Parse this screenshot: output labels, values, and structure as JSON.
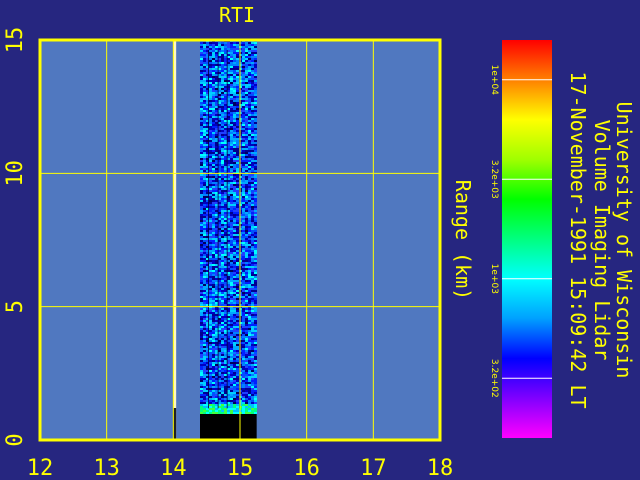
{
  "chart_data": {
    "type": "heatmap",
    "title": "RTI",
    "xlabel": "",
    "ylabel": "Range (km)",
    "xlim": [
      12,
      18
    ],
    "ylim": [
      0,
      15
    ],
    "x_ticks": [
      "12",
      "13",
      "14",
      "15",
      "16",
      "17",
      "18"
    ],
    "y_ticks": [
      "0",
      "5",
      "10",
      "15"
    ],
    "grid": true,
    "data_extent": {
      "x": [
        14.4,
        15.25
      ],
      "y": [
        1.0,
        15
      ]
    },
    "marker_line_x": 14.02,
    "colorbar": {
      "ticks": [
        "1e+04",
        "3.2e+03",
        "1e+03",
        "3.2e+02"
      ],
      "tick_fracs": [
        0.9,
        0.65,
        0.4,
        0.15
      ],
      "colors": [
        "#ff00ff",
        "#8000ff",
        "#0000ff",
        "#00a0ff",
        "#00ffff",
        "#00ff80",
        "#00ff00",
        "#a0ff00",
        "#ffff00",
        "#ff8000",
        "#ff0000"
      ]
    },
    "info_lines": [
      "University of Wisconsin",
      "Volume Imaging Lidar",
      "17-November-1991 15:09:42 LT"
    ]
  },
  "colors": {
    "background": "#262680",
    "plot_bg": "#5078c0",
    "axis": "#ffff00"
  }
}
